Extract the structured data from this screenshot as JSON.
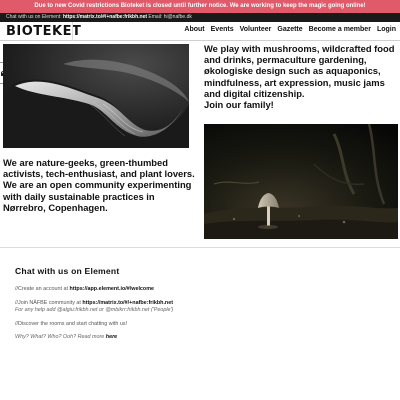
{
  "alert": {
    "text": "Due to new Covid restrictions Bioteket is closed until further notice. We are working to keep the magic going online!"
  },
  "info_bar": {
    "prefix": "Chat with us on Element:",
    "room": "https://matrix.to/#/+nafbe:frikbh.net",
    "email_label": "Email:",
    "email": "hi@nafbe.dk"
  },
  "navbar": {
    "logo": "BIOTEKET",
    "links": [
      "About",
      "Events",
      "Volunteer",
      "Gazette",
      "Become a member",
      "Login"
    ]
  },
  "side_tab": {
    "icon": "envelope-icon"
  },
  "hero": {
    "right_text": "We play with mushrooms, wildcrafted food and drinks, permaculture gardening, økologiske design such as aquaponics, mindfulness, art expression, music jams and digital citizenship.",
    "right_text_strong": "Join our family!",
    "left_text": "We are nature-geeks, green-thumbed activists, tech-enthusiast, and plant lovers. We are an open community experimenting with daily sustainable practices in Nørrebro, Copenhagen."
  },
  "chat": {
    "title": "Chat with us on Element",
    "line1_prefix": "//Create an account at",
    "line1_link": "https://app.element.io/#/welcome",
    "line2_prefix": "//Join NÄFBE community at",
    "line2_link": "https://matrix.to/#/+nafbe:frikbh.net",
    "line3_prefix": "For any help add",
    "line3_user1": "@algiu:frikbh.net",
    "line3_mid": "or",
    "line3_user2": "@mbikrr:frikbh.net",
    "line3_suffix": "('People')",
    "line4": "//Discover the rooms and start chatting with us!",
    "line5_prefix": "Why? What? Who? Ooh? Read more",
    "line5_link": "here"
  },
  "colors": {
    "alert_bg": "#e05a6a",
    "info_bg": "#1a1a1a",
    "text": "#111111"
  }
}
